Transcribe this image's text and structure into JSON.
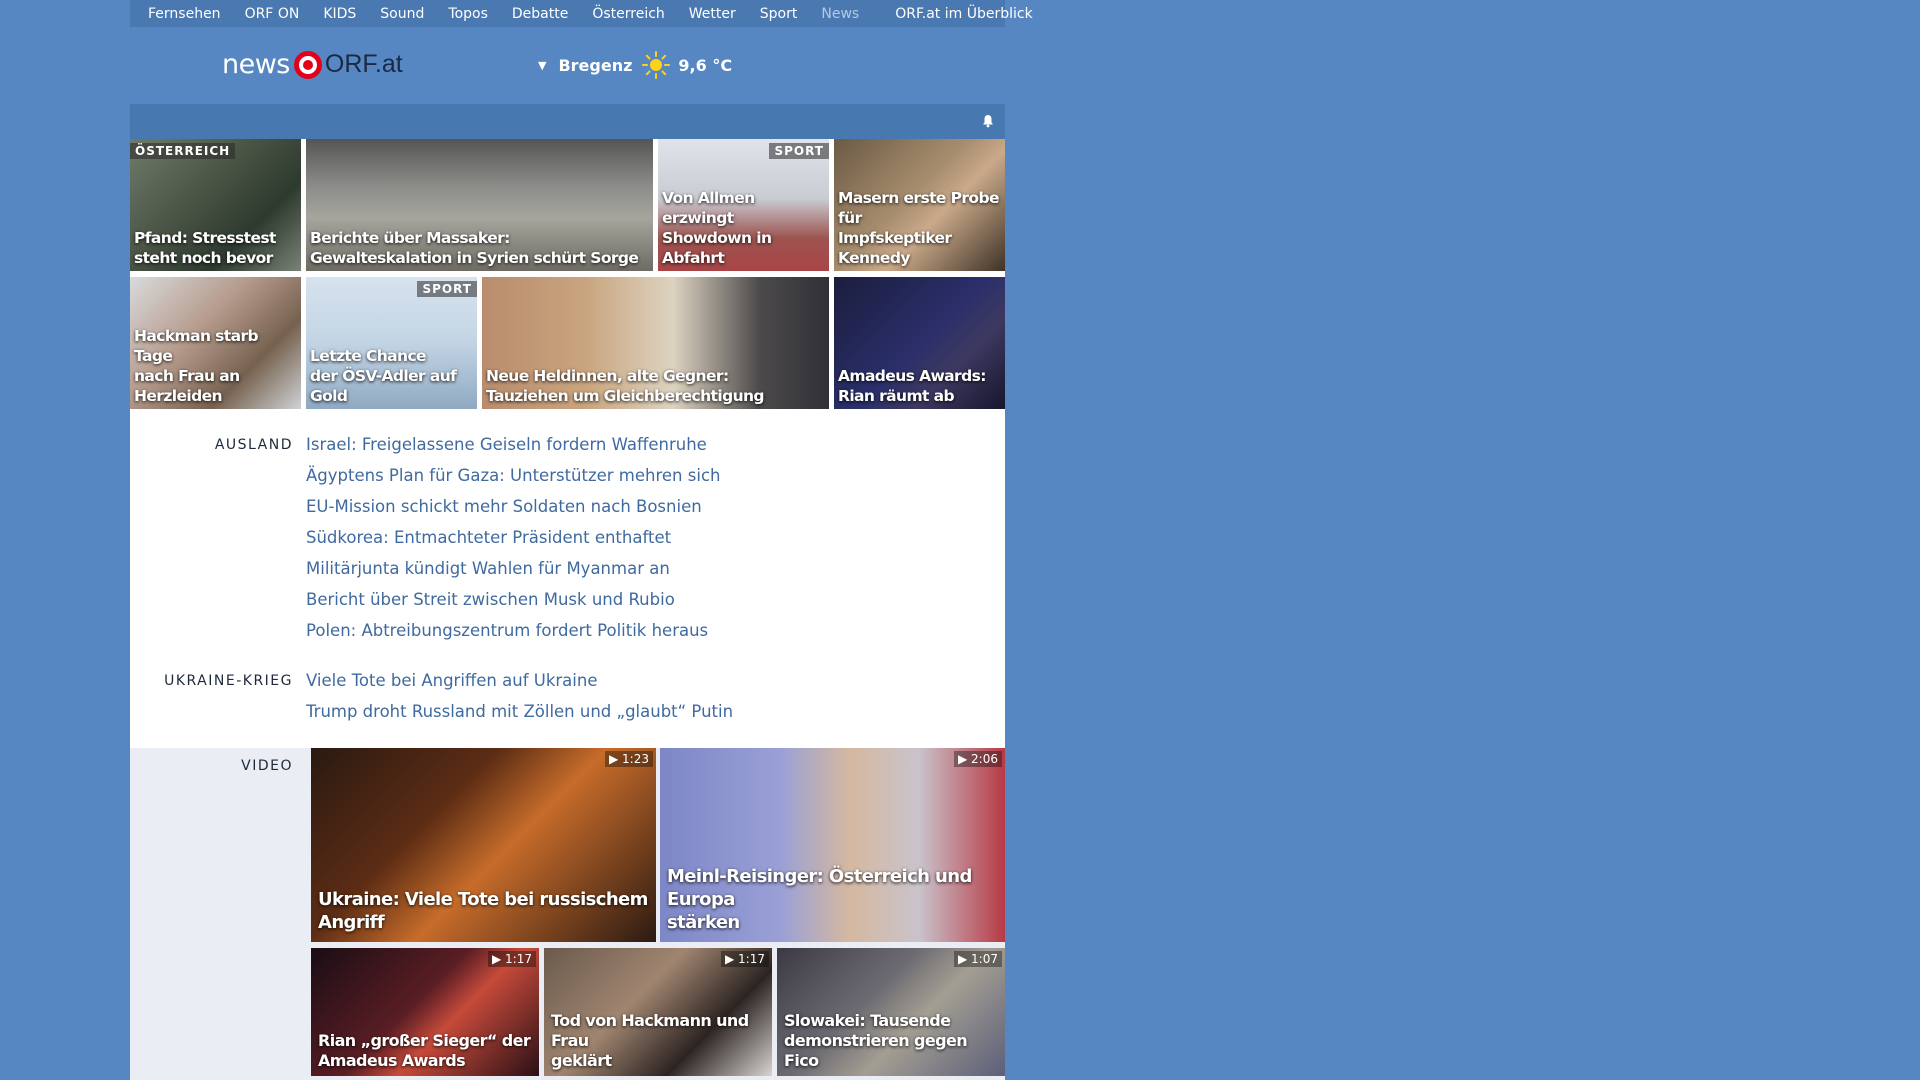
{
  "topnav": {
    "items": [
      "Fernsehen",
      "ORF ON",
      "KIDS",
      "Sound",
      "Topos",
      "Debatte",
      "Österreich",
      "Wetter",
      "Sport",
      "News"
    ],
    "overview": "ORF.at im Überblick"
  },
  "header": {
    "logo_news": "news",
    "logo_orf": "ORF.at",
    "weather_city": "Bregenz",
    "weather_temp": "9,6 °C"
  },
  "tiles": [
    {
      "tag": "ÖSTERREICH",
      "caption": "Pfand: Stresstest\nsteht noch bevor"
    },
    {
      "tag": "",
      "caption": "Berichte über Massaker:\nGewalteskalation in Syrien schürt Sorge"
    },
    {
      "tag": "SPORT",
      "caption": "Von Allmen erzwingt\nShowdown in Abfahrt"
    },
    {
      "tag": "",
      "caption": "Masern erste Probe für\nImpfskeptiker Kennedy"
    },
    {
      "tag": "",
      "caption": "Hackman starb Tage\nnach Frau an Herzleiden"
    },
    {
      "tag": "SPORT",
      "caption": "Letzte Chance\nder ÖSV-Adler auf Gold"
    },
    {
      "tag": "",
      "caption": "Neue Heldinnen, alte Gegner:\nTauziehen um Gleichberechtigung"
    },
    {
      "tag": "",
      "caption": "Amadeus Awards:\nRian räumt ab"
    }
  ],
  "ausland": {
    "label": "AUSLAND",
    "items": [
      "Israel: Freigelassene Geiseln fordern Waffenruhe",
      "Ägyptens Plan für Gaza: Unterstützer mehren sich",
      "EU-Mission schickt mehr Soldaten nach Bosnien",
      "Südkorea: Entmachteter Präsident enthaftet",
      "Militärjunta kündigt Wahlen für Myanmar an",
      "Bericht über Streit zwischen Musk und Rubio",
      "Polen: Abtreibungszentrum fordert Politik heraus"
    ]
  },
  "ukraine": {
    "label": "UKRAINE-KRIEG",
    "items": [
      "Viele Tote bei Angriffen auf Ukraine",
      "Trump droht Russland mit Zöllen und „glaubt“ Putin"
    ]
  },
  "video": {
    "label": "VIDEO",
    "items": [
      {
        "duration": "1:23",
        "caption": "Ukraine: Viele Tote bei russischem Angriff"
      },
      {
        "duration": "2:06",
        "caption": "Meinl-Reisinger: Österreich und Europa\nstärken"
      },
      {
        "duration": "1:17",
        "caption": "Rian „großer Sieger“ der\nAmadeus Awards"
      },
      {
        "duration": "1:17",
        "caption": "Tod von Hackmann und Frau\ngeklärt"
      },
      {
        "duration": "1:07",
        "caption": "Slowakei: Tausende\ndemonstrieren gegen Fico"
      }
    ]
  },
  "colors": {
    "page_bg": "#5687c2",
    "link": "#3f6aa0",
    "orf_red": "#e2001a"
  }
}
